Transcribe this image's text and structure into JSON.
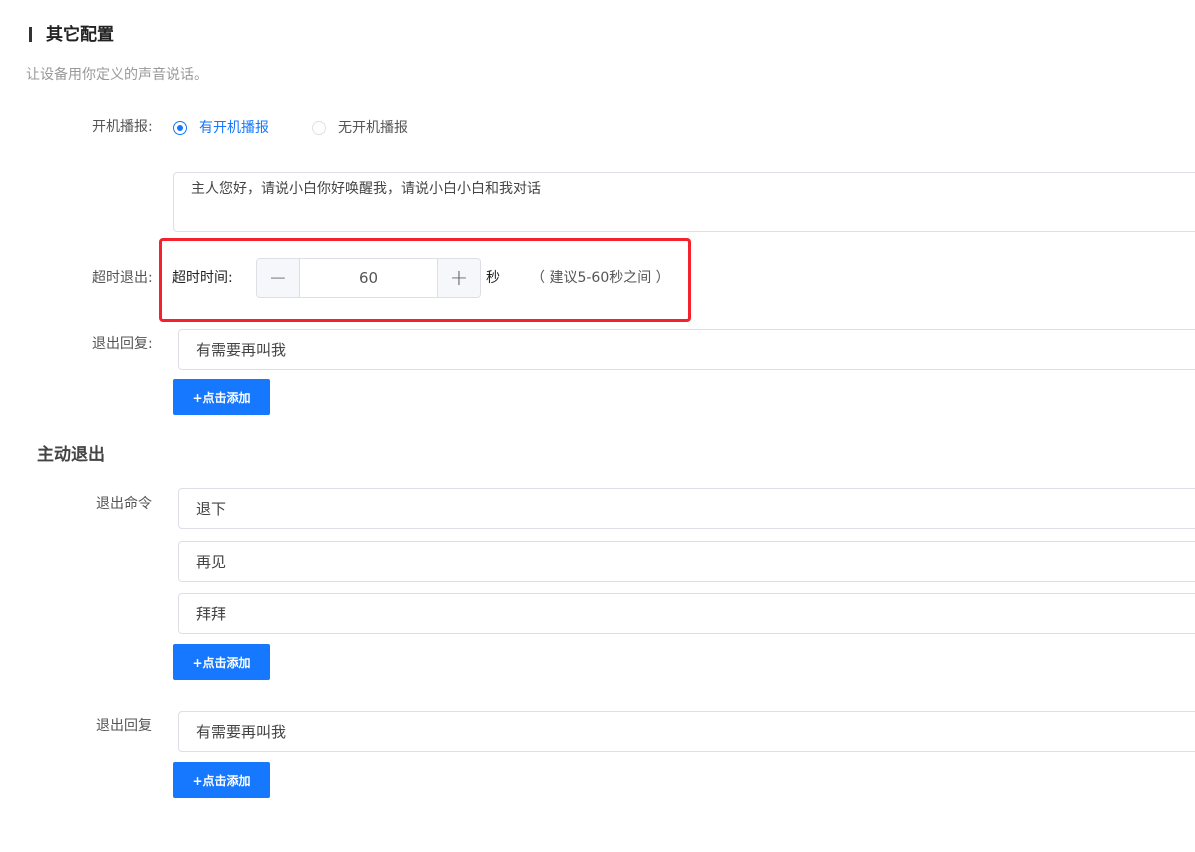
{
  "section": {
    "title": "其它配置",
    "subtitle": "让设备用你定义的声音说话。"
  },
  "boot_broadcast": {
    "label": "开机播报:",
    "options": [
      {
        "label": "有开机播报",
        "selected": true
      },
      {
        "label": "无开机播报",
        "selected": false
      }
    ],
    "text": "主人您好，请说小白你好唤醒我，请说小白小白和我对话"
  },
  "timeout": {
    "label": "超时退出:",
    "inner_label": "超时时间:",
    "value": "60",
    "unit": "秒",
    "hint": "（ 建议5-60秒之间 ）"
  },
  "exit_reply": {
    "label": "退出回复:",
    "value": "有需要再叫我",
    "add_label": "+点击添加"
  },
  "active_exit": {
    "title": "主动退出",
    "commands_label": "退出命令",
    "commands": [
      "退下",
      "再见",
      "拜拜"
    ],
    "commands_add_label": "+点击添加",
    "reply_label": "退出回复",
    "reply_value": "有需要再叫我",
    "reply_add_label": "+点击添加"
  },
  "colors": {
    "primary": "#1677ff",
    "highlight": "#f5222d"
  },
  "icons": [
    "minus-icon",
    "plus-icon"
  ]
}
